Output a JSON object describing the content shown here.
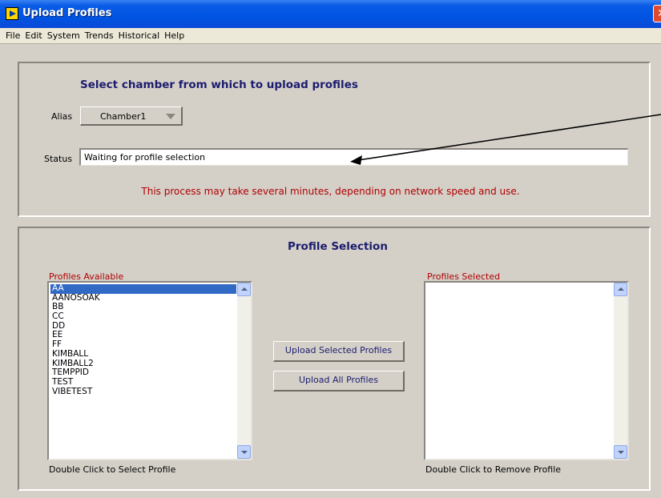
{
  "window": {
    "title": "Upload Profiles",
    "close_glyph": "✕",
    "app_icon": "labview-run-icon"
  },
  "menu": [
    "File",
    "Edit",
    "System",
    "Trends",
    "Historical",
    "Help"
  ],
  "chamber_panel": {
    "heading": "Select chamber from which to upload profiles",
    "alias_label": "Alias",
    "alias_value": "Chamber1",
    "status_label": "Status",
    "status_value": "Waiting for profile selection",
    "warning": "This process may take several minutes, depending on network speed and use."
  },
  "profile_panel": {
    "heading": "Profile Selection",
    "available_label": "Profiles Available",
    "available_items": [
      "AA",
      "AANOSOAK",
      "BB",
      "CC",
      "DD",
      "EE",
      "FF",
      "KIMBALL",
      "KIMBALL2",
      "TEMPPID",
      "TEST",
      "VIBETEST"
    ],
    "available_selected_index": 0,
    "selected_label": "Profiles Selected",
    "selected_items": [],
    "upload_selected_label": "Upload Selected Profiles",
    "upload_all_label": "Upload All Profiles",
    "available_hint": "Double Click to Select Profile",
    "selected_hint": "Double Click to Remove Profile"
  },
  "colors": {
    "heading": "#1c1c6e",
    "warning": "#b00000",
    "selection": "#316ac5",
    "titlebar": "#0054e3"
  }
}
